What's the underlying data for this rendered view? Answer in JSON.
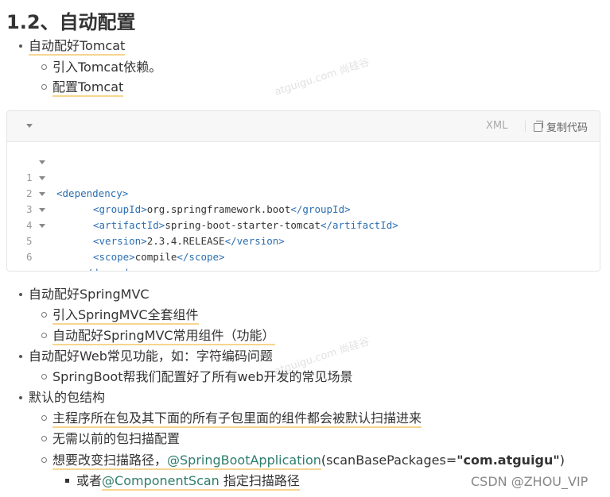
{
  "section": {
    "title": "1.2、自动配置"
  },
  "list1": {
    "item": "自动配好Tomcat",
    "sub": [
      "引入Tomcat依赖。",
      "配置Tomcat"
    ]
  },
  "code": {
    "lang": "XML",
    "copy_label": "复制代码",
    "lines": [
      {
        "n": "1",
        "open": "<dependency>",
        "text": "",
        "close": ""
      },
      {
        "n": "2",
        "open": "<groupId>",
        "text": "org.springframework.boot",
        "close": "</groupId>"
      },
      {
        "n": "3",
        "open": "<artifactId>",
        "text": "spring-boot-starter-tomcat",
        "close": "</artifactId>"
      },
      {
        "n": "4",
        "open": "<version>",
        "text": "2.3.4.RELEASE",
        "close": "</version>"
      },
      {
        "n": "5",
        "open": "<scope>",
        "text": "compile",
        "close": "</scope>"
      },
      {
        "n": "6",
        "open": "</dependency>",
        "text": "",
        "close": ""
      }
    ]
  },
  "list2": {
    "item1": "自动配好SpringMVC",
    "item1_sub": [
      "引入SpringMVC全套组件",
      "自动配好SpringMVC常用组件（功能）"
    ],
    "item2": "自动配好Web常见功能，如：字符编码问题",
    "item2_sub": [
      "SpringBoot帮我们配置好了所有web开发的常见场景"
    ],
    "item3": "默认的包结构",
    "item3_sub1": "主程序所在包及其下面的所有子包里面的组件都会被默认扫描进来",
    "item3_sub2": "无需以前的包扫描配置",
    "item3_sub3_prefix": "想要改变扫描路径，",
    "item3_sub3_annotation": "@SpringBootApplication",
    "item3_sub3_args_start": "(scanBasePackages=",
    "item3_sub3_value": "\"com.atguigu\"",
    "item3_sub3_args_end": ")",
    "item3_sub3_child_prefix": "或者",
    "item3_sub3_child_annotation": "@ComponentScan",
    "item3_sub3_child_suffix": " 指定扫描路径"
  },
  "watermark": "atguigu.com 尚硅谷",
  "attribution": "CSDN @ZHOU_VIP"
}
